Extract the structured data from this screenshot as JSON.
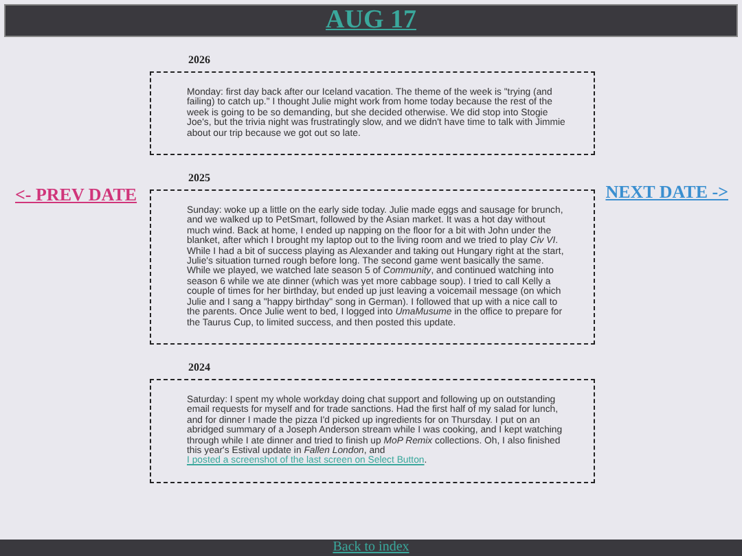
{
  "header": {
    "title": "AUG 17"
  },
  "nav": {
    "prev": "<- PREV DATE",
    "next": "NEXT DATE ->"
  },
  "entries": [
    {
      "year": "2026",
      "parts": [
        {
          "kind": "text",
          "text": "Monday: first day back after our Iceland vacation. The theme of the week is \"trying (and failing) to catch up.\" I thought Julie might work from home today because the rest of the week is going to be so demanding, but she decided otherwise. We did stop into Stogie Joe's, but the trivia night was frustratingly slow, and we didn't have time to talk with Jimmie about our trip because we got out so late."
        }
      ]
    },
    {
      "year": "2025",
      "parts": [
        {
          "kind": "text",
          "text": "Sunday: woke up a little on the early side today. Julie made eggs and sausage for brunch, and we walked up to PetSmart, followed by the Asian market. It was a hot day without much wind. Back at home, I ended up napping on the floor for a bit with John under the blanket, after which I brought my laptop out to the living room and we tried to play *Civ VI*. While I had a bit of success playing as Alexander and taking out Hungary right at the start, Julie's situation turned rough before long. The second game went basically the same. While we played, we watched late season 5 of *Community*, and continued watching into season 6 while we ate dinner (which was yet more cabbage soup). I tried to call Kelly a couple of times for her birthday, but ended up just leaving a voicemail message (on which Julie and I sang a \"happy birthday\" song in German). I followed that up with a nice call to the parents. Once Julie went to bed, I logged into *UmaMusume* in the office to prepare for the Taurus Cup, to limited success, and then posted this update."
        }
      ]
    },
    {
      "year": "2024",
      "parts": [
        {
          "kind": "text",
          "text": "Saturday: I spent my whole workday doing chat support and following up on outstanding email requests for myself and for trade sanctions. Had the first half of my salad for lunch, and for dinner I made the pizza I'd picked up ingredients for on Thursday. I put on an abridged summary of a Joseph Anderson stream while I was cooking, and I kept watching through while I ate dinner and tried to finish up *MoP Remix* collections. Oh, I also finished this year's Estival update in *Fallen London*, and "
        },
        {
          "kind": "link",
          "text": "I posted a screenshot of the last screen on Select Button"
        },
        {
          "kind": "text",
          "text": "."
        }
      ]
    }
  ],
  "footer": {
    "link": "Back to index"
  }
}
